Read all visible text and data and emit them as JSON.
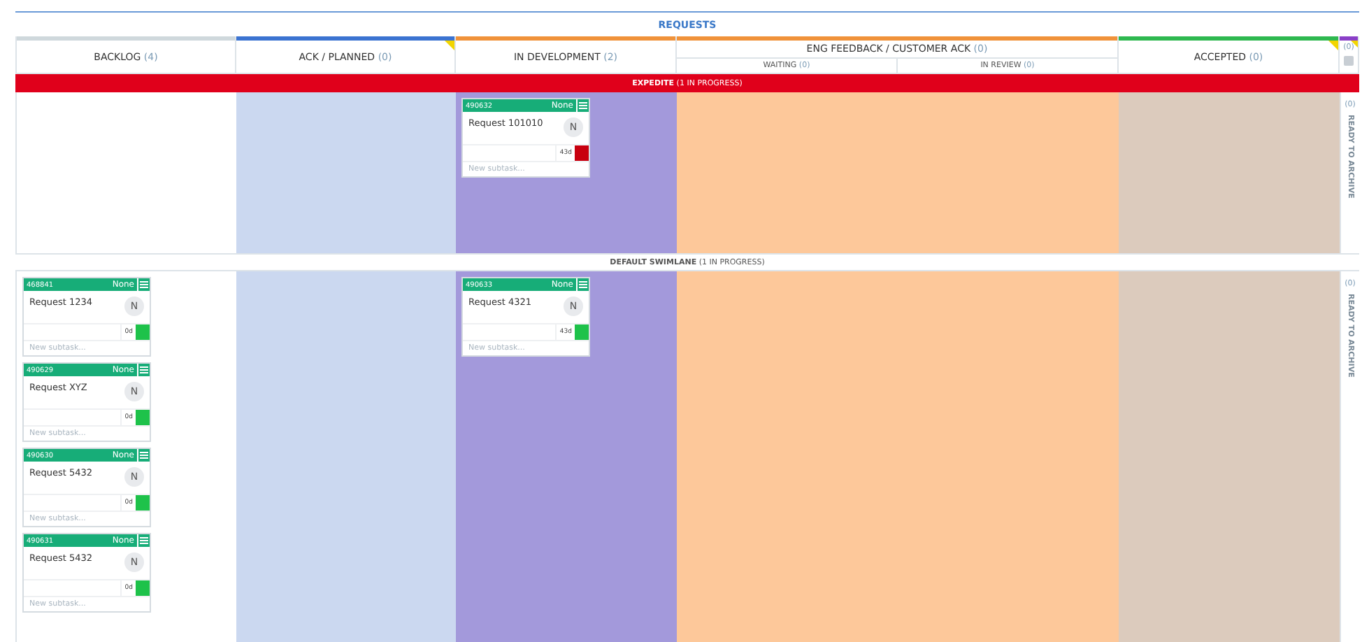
{
  "board": {
    "title": "REQUESTS"
  },
  "columns": [
    {
      "name": "BACKLOG",
      "count": "(4)",
      "color": "#cfd8dc",
      "flagged": false
    },
    {
      "name": "ACK / PLANNED",
      "count": "(0)",
      "color": "#3b73d1",
      "flagged": true
    },
    {
      "name": "IN DEVELOPMENT",
      "count": "(2)",
      "color": "#f0923a",
      "flagged": false
    },
    {
      "name": "ENG FEEDBACK / CUSTOMER ACK",
      "count": "(0)",
      "color": "#f0923a",
      "flagged": false,
      "children": [
        {
          "name": "WAITING",
          "count": "(0)"
        },
        {
          "name": "IN REVIEW",
          "count": "(0)"
        }
      ]
    },
    {
      "name": "ACCEPTED",
      "count": "(0)",
      "color": "#2eb84f",
      "flagged": true
    }
  ],
  "archive": {
    "count": "(0)",
    "color": "#8a3fc7",
    "flagged": true
  },
  "lanes": [
    {
      "kind": "expedite",
      "title": "EXPEDITE",
      "note": "(1 IN PROGRESS)",
      "archive": {
        "count": "(0)",
        "label": "READY TO ARCHIVE"
      },
      "cells": {
        "in_development": [
          {
            "id": "490632",
            "owner": "None",
            "title": "Request 101010",
            "avatar": "N",
            "age": "43d",
            "color": "#c8000f",
            "placeholder": "New subtask..."
          }
        ]
      }
    },
    {
      "kind": "default",
      "title": "DEFAULT SWIMLANE",
      "note": "(1 IN PROGRESS)",
      "archive": {
        "count": "(0)",
        "label": "READY TO ARCHIVE"
      },
      "cells": {
        "backlog": [
          {
            "id": "468841",
            "owner": "None",
            "title": "Request 1234",
            "avatar": "N",
            "age": "0d",
            "color": "#1ec24a",
            "placeholder": "New subtask..."
          },
          {
            "id": "490629",
            "owner": "None",
            "title": "Request XYZ",
            "avatar": "N",
            "age": "0d",
            "color": "#1ec24a",
            "placeholder": "New subtask..."
          },
          {
            "id": "490630",
            "owner": "None",
            "title": "Request 5432",
            "avatar": "N",
            "age": "0d",
            "color": "#1ec24a",
            "placeholder": "New subtask..."
          },
          {
            "id": "490631",
            "owner": "None",
            "title": "Request 5432",
            "avatar": "N",
            "age": "0d",
            "color": "#1ec24a",
            "placeholder": "New subtask..."
          }
        ],
        "in_development": [
          {
            "id": "490633",
            "owner": "None",
            "title": "Request 4321",
            "avatar": "N",
            "age": "43d",
            "color": "#1ec24a",
            "placeholder": "New subtask..."
          }
        ]
      }
    }
  ]
}
